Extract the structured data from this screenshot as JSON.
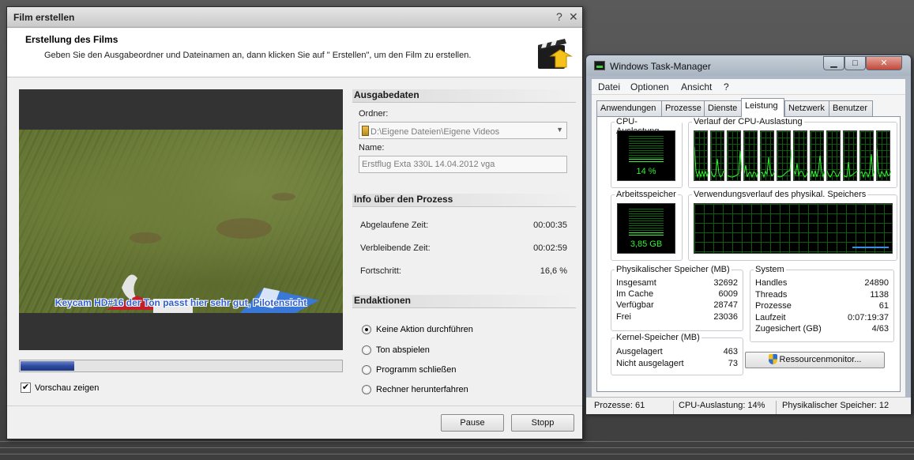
{
  "film_dialog": {
    "title": "Film erstellen",
    "header_title": "Erstellung des Films",
    "header_desc": "Geben Sie den Ausgabeordner und Dateinamen an, dann klicken Sie auf \" Erstellen\", um den Film zu erstellen.",
    "close_glyph": "✕",
    "help_glyph": "?",
    "preview_caption": "Keycam HD#16 der Ton passt hier sehr gut, Pilotensicht",
    "progress_fraction": 0.166,
    "preview_checkbox_label": "Vorschau zeigen",
    "preview_checked": true,
    "output": {
      "section_title": "Ausgabedaten",
      "folder_label": "Ordner:",
      "folder_value": "D:\\Eigene Dateien\\Eigene Videos",
      "name_label": "Name:",
      "name_value": "Erstflug Exta 330L 14.04.2012 vga"
    },
    "process": {
      "section_title": "Info über den Prozess",
      "elapsed_label": "Abgelaufene Zeit:",
      "elapsed_value": "00:00:35",
      "remaining_label": "Verbleibende Zeit:",
      "remaining_value": "00:02:59",
      "progress_label": "Fortschritt:",
      "progress_value": "16,6 %"
    },
    "end_actions": {
      "section_title": "Endaktionen",
      "options": [
        "Keine Aktion durchführen",
        "Ton abspielen",
        "Programm schließen",
        "Rechner herunterfahren"
      ],
      "selected_index": 0
    },
    "pause_label": "Pause",
    "stop_label": "Stopp"
  },
  "task_manager": {
    "title": "Windows Task-Manager",
    "window_buttons": {
      "minimize": "▁",
      "maximize": "□",
      "close": "✕"
    },
    "menu": [
      "Datei",
      "Optionen",
      "Ansicht",
      "?"
    ],
    "tabs": [
      "Anwendungen",
      "Prozesse",
      "Dienste",
      "Leistung",
      "Netzwerk",
      "Benutzer"
    ],
    "active_tab": "Leistung",
    "cpu_usage_title": "CPU-Auslastung",
    "cpu_usage_value": "14 %",
    "cpu_usage_fraction": 0.14,
    "cpu_history_title": "Verlauf der CPU-Auslastung",
    "memory_title": "Arbeitsspeicher",
    "memory_value": "3,85 GB",
    "memory_fraction": 0.12,
    "memory_history_title": "Verwendungsverlauf des physikal. Speichers",
    "physical_memory": {
      "title": "Physikalischer Speicher (MB)",
      "rows": [
        {
          "label": "Insgesamt",
          "value": "32692"
        },
        {
          "label": "Im Cache",
          "value": "6009"
        },
        {
          "label": "Verfügbar",
          "value": "28747"
        },
        {
          "label": "Frei",
          "value": "23036"
        }
      ]
    },
    "system": {
      "title": "System",
      "rows": [
        {
          "label": "Handles",
          "value": "24890"
        },
        {
          "label": "Threads",
          "value": "1138"
        },
        {
          "label": "Prozesse",
          "value": "61"
        },
        {
          "label": "Laufzeit",
          "value": "0:07:19:37"
        },
        {
          "label": "Zugesichert (GB)",
          "value": "4/63"
        }
      ]
    },
    "kernel_memory": {
      "title": "Kernel-Speicher (MB)",
      "rows": [
        {
          "label": "Ausgelagert",
          "value": "463"
        },
        {
          "label": "Nicht ausgelagert",
          "value": "73"
        }
      ]
    },
    "resource_monitor_label": "Ressourcenmonitor...",
    "status": {
      "processes": "Prozesse: 61",
      "cpu": "CPU-Auslastung: 14%",
      "memory": "Physikalischer Speicher: 12"
    },
    "colors": {
      "graph_line": "#35f335",
      "grid": "#0b5f0b",
      "memory_line": "#3b8fe8"
    }
  }
}
